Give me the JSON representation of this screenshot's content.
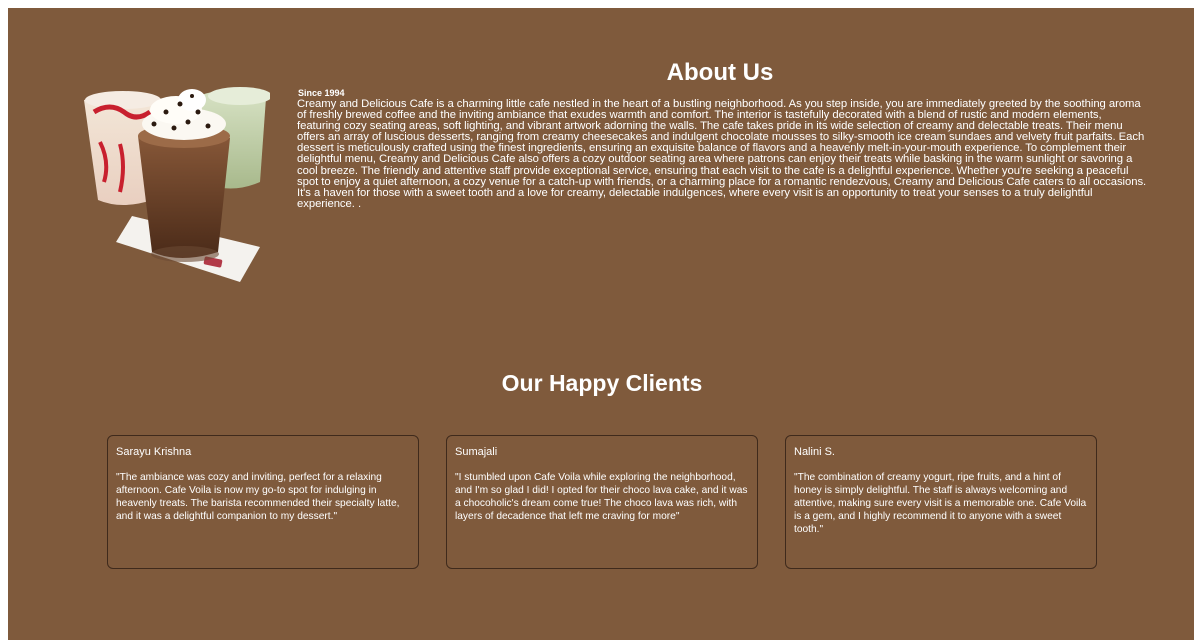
{
  "about": {
    "title": "About Us",
    "since": "Since 1994",
    "text": "Creamy and Delicious Cafe is a charming little cafe nestled in the heart of a bustling neighborhood. As you step inside, you are immediately greeted by the soothing aroma of freshly brewed coffee and the inviting ambiance that exudes warmth and comfort. The interior is tastefully decorated with a blend of rustic and modern elements, featuring cozy seating areas, soft lighting, and vibrant artwork adorning the walls. The cafe takes pride in its wide selection of creamy and delectable treats. Their menu offers an array of luscious desserts, ranging from creamy cheesecakes and indulgent chocolate mousses to silky-smooth ice cream sundaes and velvety fruit parfaits. Each dessert is meticulously crafted using the finest ingredients, ensuring an exquisite balance of flavors and a heavenly melt-in-your-mouth experience. To complement their delightful menu, Creamy and Delicious Cafe also offers a cozy outdoor seating area where patrons can enjoy their treats while basking in the warm sunlight or savoring a cool breeze. The friendly and attentive staff provide exceptional service, ensuring that each visit to the cafe is a delightful experience. Whether you're seeking a peaceful spot to enjoy a quiet afternoon, a cozy venue for a catch-up with friends, or a charming place for a romantic rendezvous, Creamy and Delicious Cafe caters to all occasions. It's a haven for those with a sweet tooth and a love for creamy, delectable indulgences, where every visit is an opportunity to treat your senses to a truly delightful experience. ."
  },
  "clients": {
    "title": "Our Happy Clients",
    "items": [
      {
        "name": "Sarayu Krishna",
        "quote": "\"The ambiance was cozy and inviting, perfect for a relaxing afternoon. Cafe Voila is now my go-to spot for indulging in heavenly treats. The barista recommended their specialty latte, and it was a delightful companion to my dessert.\""
      },
      {
        "name": "Sumajali",
        "quote": "\"I stumbled upon Cafe Voila while exploring the neighborhood, and I'm so glad I did! I opted for their choco lava cake, and it was a chocoholic's dream come true! The choco lava was rich, with layers of decadence that left me craving for more\""
      },
      {
        "name": "Nalini S.",
        "quote": "\"The combination of creamy yogurt, ripe fruits, and a hint of honey is simply delightful. The staff is always welcoming and attentive, making sure every visit is a memorable one. Cafe Voila is a gem, and I highly recommend it to anyone with a sweet tooth.\""
      }
    ]
  },
  "colors": {
    "background": "#7f5a3c",
    "card_border": "#3f2a1c",
    "text": "#ffffff"
  }
}
